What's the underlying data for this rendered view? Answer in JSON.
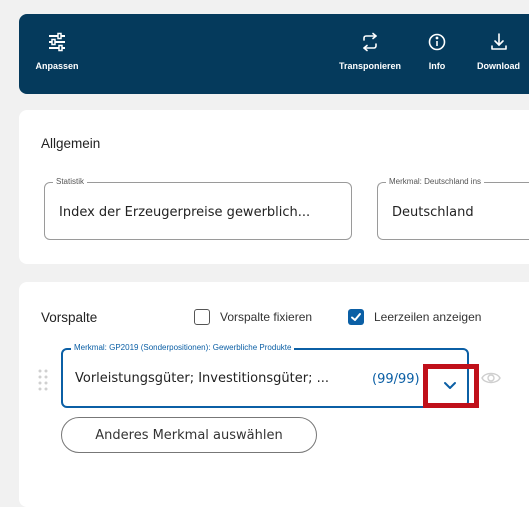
{
  "toolbar": {
    "adjust_label": "Anpassen",
    "transpose_label": "Transponieren",
    "info_label": "Info",
    "download_label": "Download"
  },
  "general": {
    "title": "Allgemein",
    "statistic": {
      "legend": "Statistik",
      "value": "Index der Erzeugerpreise gewerblich..."
    },
    "feature": {
      "legend": "Merkmal: Deutschland ins",
      "value": "Deutschland"
    }
  },
  "row_header": {
    "title": "Vorspalte",
    "fix_label": "Vorspalte fixieren",
    "fix_checked": false,
    "empty_rows_label": "Leerzeilen anzeigen",
    "empty_rows_checked": true,
    "select": {
      "legend": "Merkmal: GP2019 (Sonderpositionen): Gewerbliche Produkte",
      "value": "Vorleistungsgüter; Investitionsgüter; ...",
      "count": "(99/99)"
    },
    "other_feature_label": "Anderes Merkmal auswählen"
  },
  "colors": {
    "toolbar_bg": "#053a5c",
    "accent": "#0b5fa5",
    "highlight": "#c0101a"
  },
  "icons": {
    "adjust": "sliders-icon",
    "transpose": "swap-arrows-icon",
    "info": "info-icon",
    "download": "download-icon",
    "expand": "chevron-down-icon",
    "visibility": "eye-icon",
    "drag": "drag-handle-icon"
  }
}
